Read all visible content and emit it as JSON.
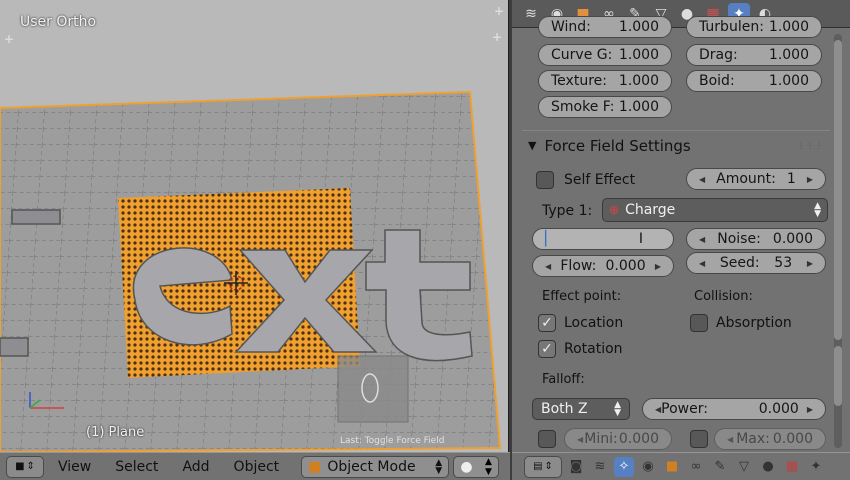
{
  "viewport": {
    "name": "User Ortho",
    "object_label": "(1) Plane",
    "last_operator": "Last: Toggle Force Field"
  },
  "viewport_header": {
    "menus": [
      "View",
      "Select",
      "Add",
      "Object"
    ],
    "mode": "Object Mode"
  },
  "properties": {
    "tabs": [
      "render-layers-icon",
      "world-icon",
      "object-icon",
      "constraints-icon",
      "modifier-icon",
      "data-icon",
      "material-icon",
      "texture-icon",
      "particles-icon",
      "physics-icon"
    ],
    "active_tab": "physics-icon",
    "top_fields": {
      "wind": {
        "label": "Wind:",
        "value": "1.000"
      },
      "turbulence": {
        "label": "Turbulen:",
        "value": "1.000"
      },
      "curve_guide": {
        "label": "Curve G:",
        "value": "1.000"
      },
      "drag": {
        "label": "Drag:",
        "value": "1.000"
      },
      "texture": {
        "label": "Texture:",
        "value": "1.000"
      },
      "boid": {
        "label": "Boid:",
        "value": "1.000"
      },
      "smoke_flow": {
        "label": "Smoke F:",
        "value": "1.000"
      }
    },
    "panel_title": "Force Field Settings",
    "self_effect": {
      "label": "Self Effect",
      "checked": false
    },
    "amount": {
      "label": "Amount:",
      "value": "1"
    },
    "type": {
      "label": "Type 1:",
      "value": "Charge"
    },
    "strength_value": "",
    "noise": {
      "label": "Noise:",
      "value": "0.000"
    },
    "flow": {
      "label": "Flow:",
      "value": "0.000"
    },
    "seed": {
      "label": "Seed:",
      "value": "53"
    },
    "effect_point": {
      "label": "Effect point:",
      "location": {
        "label": "Location",
        "checked": true
      },
      "rotation": {
        "label": "Rotation",
        "checked": true
      }
    },
    "collision": {
      "label": "Collision:",
      "absorption": {
        "label": "Absorption",
        "checked": false
      }
    },
    "falloff": {
      "label": "Falloff:",
      "shape": "Both Z",
      "power": {
        "label": "Power:",
        "value": "0.000"
      },
      "min": {
        "label": "Mini:",
        "value": "0.000"
      },
      "max": {
        "label": "Max:",
        "value": "0.000"
      }
    }
  },
  "colors": {
    "accent": "#5680c2",
    "selection_orange": "#f0a030",
    "panel_bg": "#727272"
  }
}
